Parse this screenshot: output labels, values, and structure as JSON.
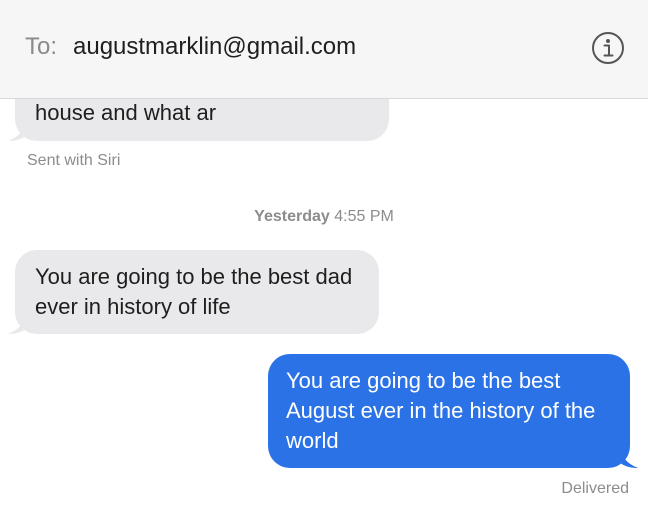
{
  "header": {
    "to_label": "To:",
    "recipient": "augustmarklin@gmail.com",
    "info_icon": "info-circle-icon"
  },
  "messages": [
    {
      "direction": "incoming",
      "text": "house and what ar"
    },
    {
      "direction": "incoming",
      "text": "You are going to be the best dad ever in history of life"
    },
    {
      "direction": "outgoing",
      "text": "You are going to be the best August ever in the history of the world"
    }
  ],
  "sent_with": "Sent with Siri",
  "timestamp": {
    "day": "Yesterday",
    "time": "4:55 PM"
  },
  "delivered": "Delivered",
  "colors": {
    "incoming_bubble": "#e9e9eb",
    "outgoing_bubble": "#2b72e6",
    "header_bg": "#f6f6f6",
    "meta_text": "#8c8c8c"
  }
}
